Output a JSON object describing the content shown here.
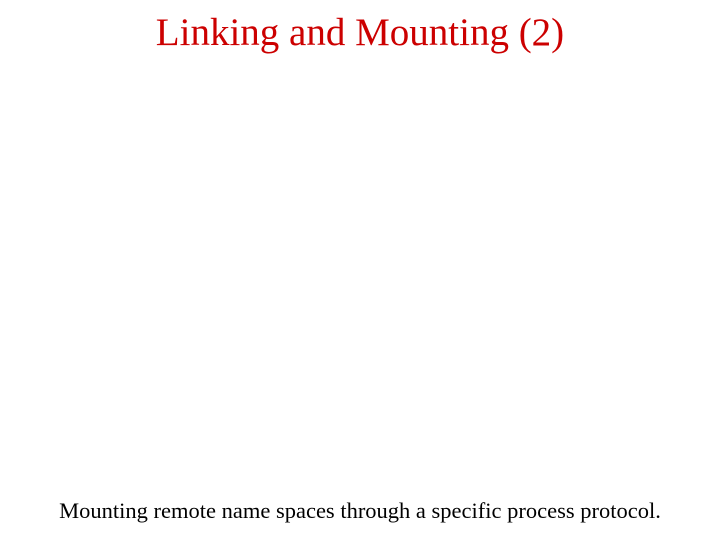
{
  "title": "Linking and Mounting (2)",
  "caption": "Mounting remote name spaces through a specific process protocol."
}
